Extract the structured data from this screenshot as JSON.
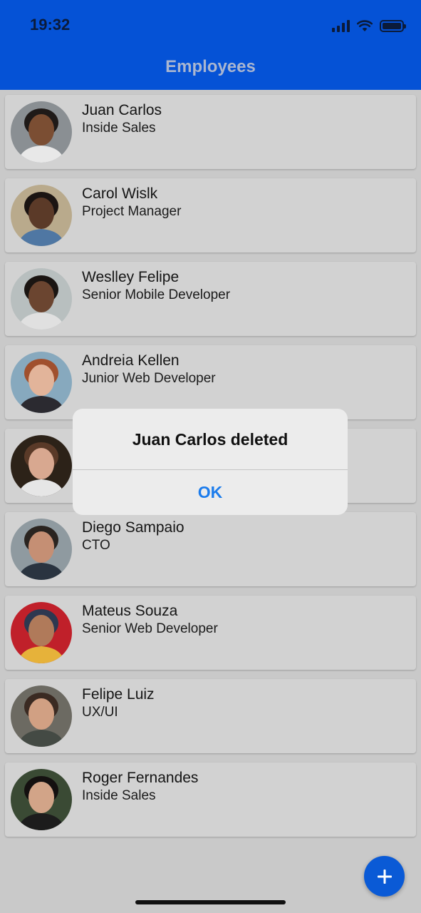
{
  "status_bar": {
    "time": "19:32",
    "icons": [
      "cellular-signal-icon",
      "wifi-icon",
      "battery-icon"
    ]
  },
  "header": {
    "title": "Employees"
  },
  "employees": [
    {
      "name": "Juan Carlos",
      "role": "Inside Sales",
      "avatar_colors": [
        "#8a8f93",
        "#7b4e33",
        "#1f1a18",
        "#e8e8e8"
      ]
    },
    {
      "name": "Carol Wislk",
      "role": "Project Manager",
      "avatar_colors": [
        "#b9aa8c",
        "#5b3a28",
        "#1b1412",
        "#4f77a3"
      ]
    },
    {
      "name": "Weslley Felipe",
      "role": "Senior Mobile Developer",
      "avatar_colors": [
        "#b8bfbf",
        "#6b4530",
        "#1a1512",
        "#e0e0e0"
      ]
    },
    {
      "name": "Andreia Kellen",
      "role": "Junior Web Developer",
      "avatar_colors": [
        "#87a9be",
        "#e2b49a",
        "#a0502e",
        "#2b2a30"
      ]
    },
    {
      "name": "",
      "role": "",
      "avatar_colors": [
        "#2c2218",
        "#d8a890",
        "#5a3a28",
        "#e6e6e6"
      ]
    },
    {
      "name": "Diego Sampaio",
      "role": "CTO",
      "avatar_colors": [
        "#8f9aa0",
        "#c58f74",
        "#2a2420",
        "#2a3440"
      ]
    },
    {
      "name": "Mateus Souza",
      "role": "Senior Web Developer",
      "avatar_colors": [
        "#c0202a",
        "#b07a5a",
        "#2e3850",
        "#e6b23a"
      ]
    },
    {
      "name": "Felipe Luiz",
      "role": "UX/UI",
      "avatar_colors": [
        "#6c6a62",
        "#d1a083",
        "#3a2a22",
        "#444a44"
      ]
    },
    {
      "name": "Roger Fernandes",
      "role": "Inside Sales",
      "avatar_colors": [
        "#3a4a34",
        "#d2a488",
        "#141010",
        "#1c1c1c"
      ]
    }
  ],
  "alert": {
    "title": "Juan Carlos deleted",
    "ok_label": "OK"
  },
  "fab": {
    "icon": "plus-icon"
  },
  "colors": {
    "header_bg": "#0552d6",
    "accent": "#1c7cec",
    "fab_bg": "#0a5ad6"
  }
}
